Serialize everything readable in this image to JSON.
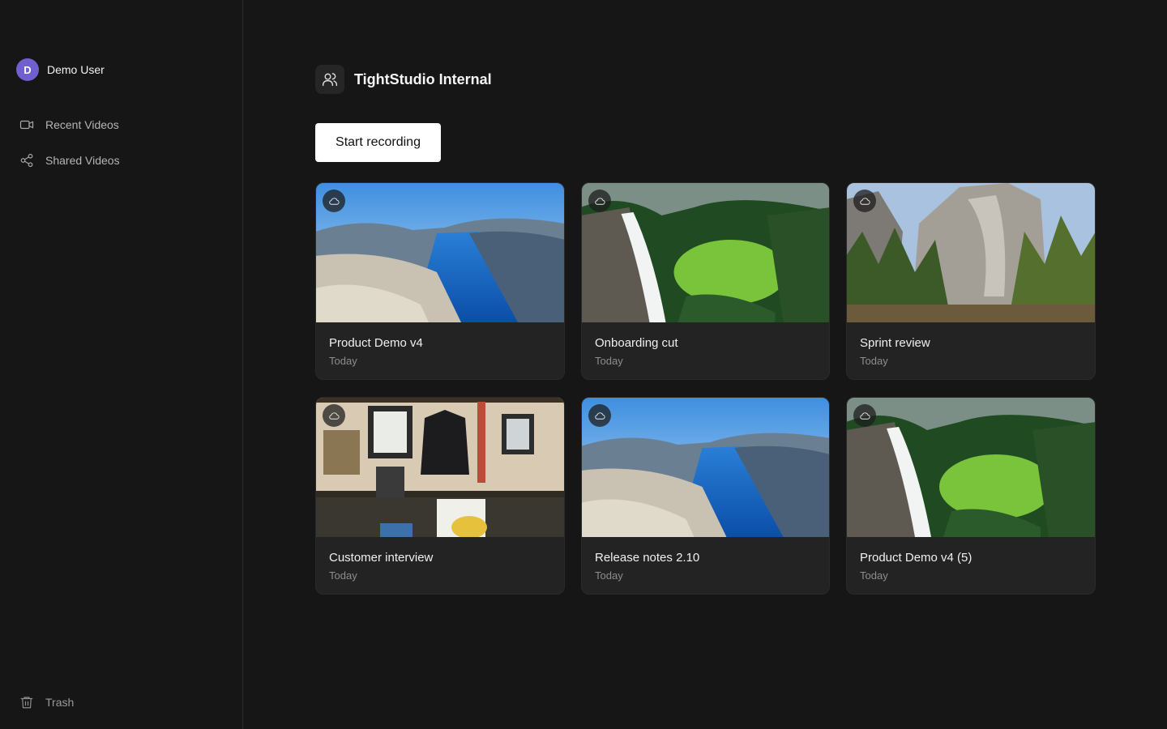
{
  "user": {
    "initial": "D",
    "name": "Demo User",
    "avatar_color": "#6f5fcf"
  },
  "nav": [
    {
      "label": "Recent Videos",
      "icon": "video-camera-icon"
    },
    {
      "label": "Shared Videos",
      "icon": "share-icon"
    }
  ],
  "trash": {
    "label": "Trash",
    "icon": "trash-icon"
  },
  "space": {
    "title": "TightStudio Internal",
    "icon": "users-icon"
  },
  "record_button": {
    "label": "Start recording"
  },
  "videos": [
    {
      "title": "Product Demo v4",
      "date": "Today",
      "thumbnail": "fjord",
      "badge_icon": "cloud-icon"
    },
    {
      "title": "Onboarding cut",
      "date": "Today",
      "thumbnail": "waterfall",
      "badge_icon": "cloud-icon"
    },
    {
      "title": "Sprint review",
      "date": "Today",
      "thumbnail": "cliff-forest",
      "badge_icon": "cloud-icon"
    },
    {
      "title": "Customer interview",
      "date": "Today",
      "thumbnail": "interior-wall",
      "badge_icon": "cloud-icon"
    },
    {
      "title": "Release notes 2.10",
      "date": "Today",
      "thumbnail": "fjord",
      "badge_icon": "cloud-icon"
    },
    {
      "title": "Product Demo v4 (5)",
      "date": "Today",
      "thumbnail": "waterfall",
      "badge_icon": "cloud-icon"
    }
  ],
  "colors": {
    "background": "#161616",
    "card": "#232323",
    "accent": "#6f5fcf",
    "button_bg": "#ffffff"
  }
}
